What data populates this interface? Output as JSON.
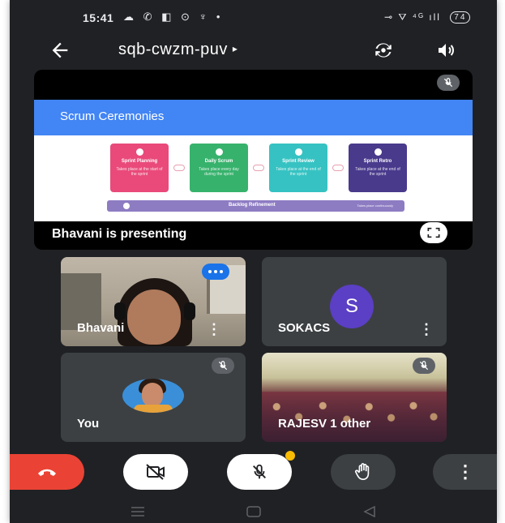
{
  "status_bar": {
    "time": "15:41",
    "left_icons": "☁ ✆ ◧ ⊙ ♆ •",
    "right_icons": "⊸ ⛛ ⁴ᴳ ıll",
    "battery": "74"
  },
  "top_bar": {
    "meeting_code": "sqb-cwzm-puv",
    "caret": "▸"
  },
  "presentation": {
    "slide_title": "Scrum Ceremonies",
    "cards": [
      {
        "name": "Sprint Planning",
        "desc": "Takes place at the start of the sprint",
        "color": "#e94a7a"
      },
      {
        "name": "Daily Scrum",
        "desc": "Takes place every day during the sprint",
        "color": "#37b26c"
      },
      {
        "name": "Sprint Review",
        "desc": "Takes place at the end of the sprint",
        "color": "#36c2c2"
      },
      {
        "name": "Sprint Retro",
        "desc": "Takes place at the end of the sprint",
        "color": "#4a3a8c"
      }
    ],
    "backlog_label": "Backlog Refinement",
    "backlog_note": "Takes place continuously",
    "presenting_text": "Bhavani is presenting"
  },
  "participants": {
    "bhavani": {
      "name": "Bhavani"
    },
    "sokacs": {
      "initial": "S",
      "name": "SOKACS",
      "avatar_color": "#5b3fc4"
    },
    "you": {
      "name": "You"
    },
    "rajesh": {
      "name": "RAJESV  1 other"
    }
  },
  "controls": {
    "more_glyph": "⋮"
  },
  "colors": {
    "background": "#202124",
    "tile": "#3c4043",
    "end_call": "#ea4335",
    "speaking": "#1a73e8",
    "slide_header": "#4285f4",
    "notification": "#fbbc04"
  },
  "icons": [
    "back-arrow-icon",
    "switch-camera-icon",
    "speaker-icon",
    "mic-off-icon",
    "fullscreen-icon",
    "more-vert-icon",
    "end-call-icon",
    "camera-off-icon",
    "raise-hand-icon",
    "nav-menu-icon",
    "nav-home-icon",
    "nav-back-icon"
  ]
}
